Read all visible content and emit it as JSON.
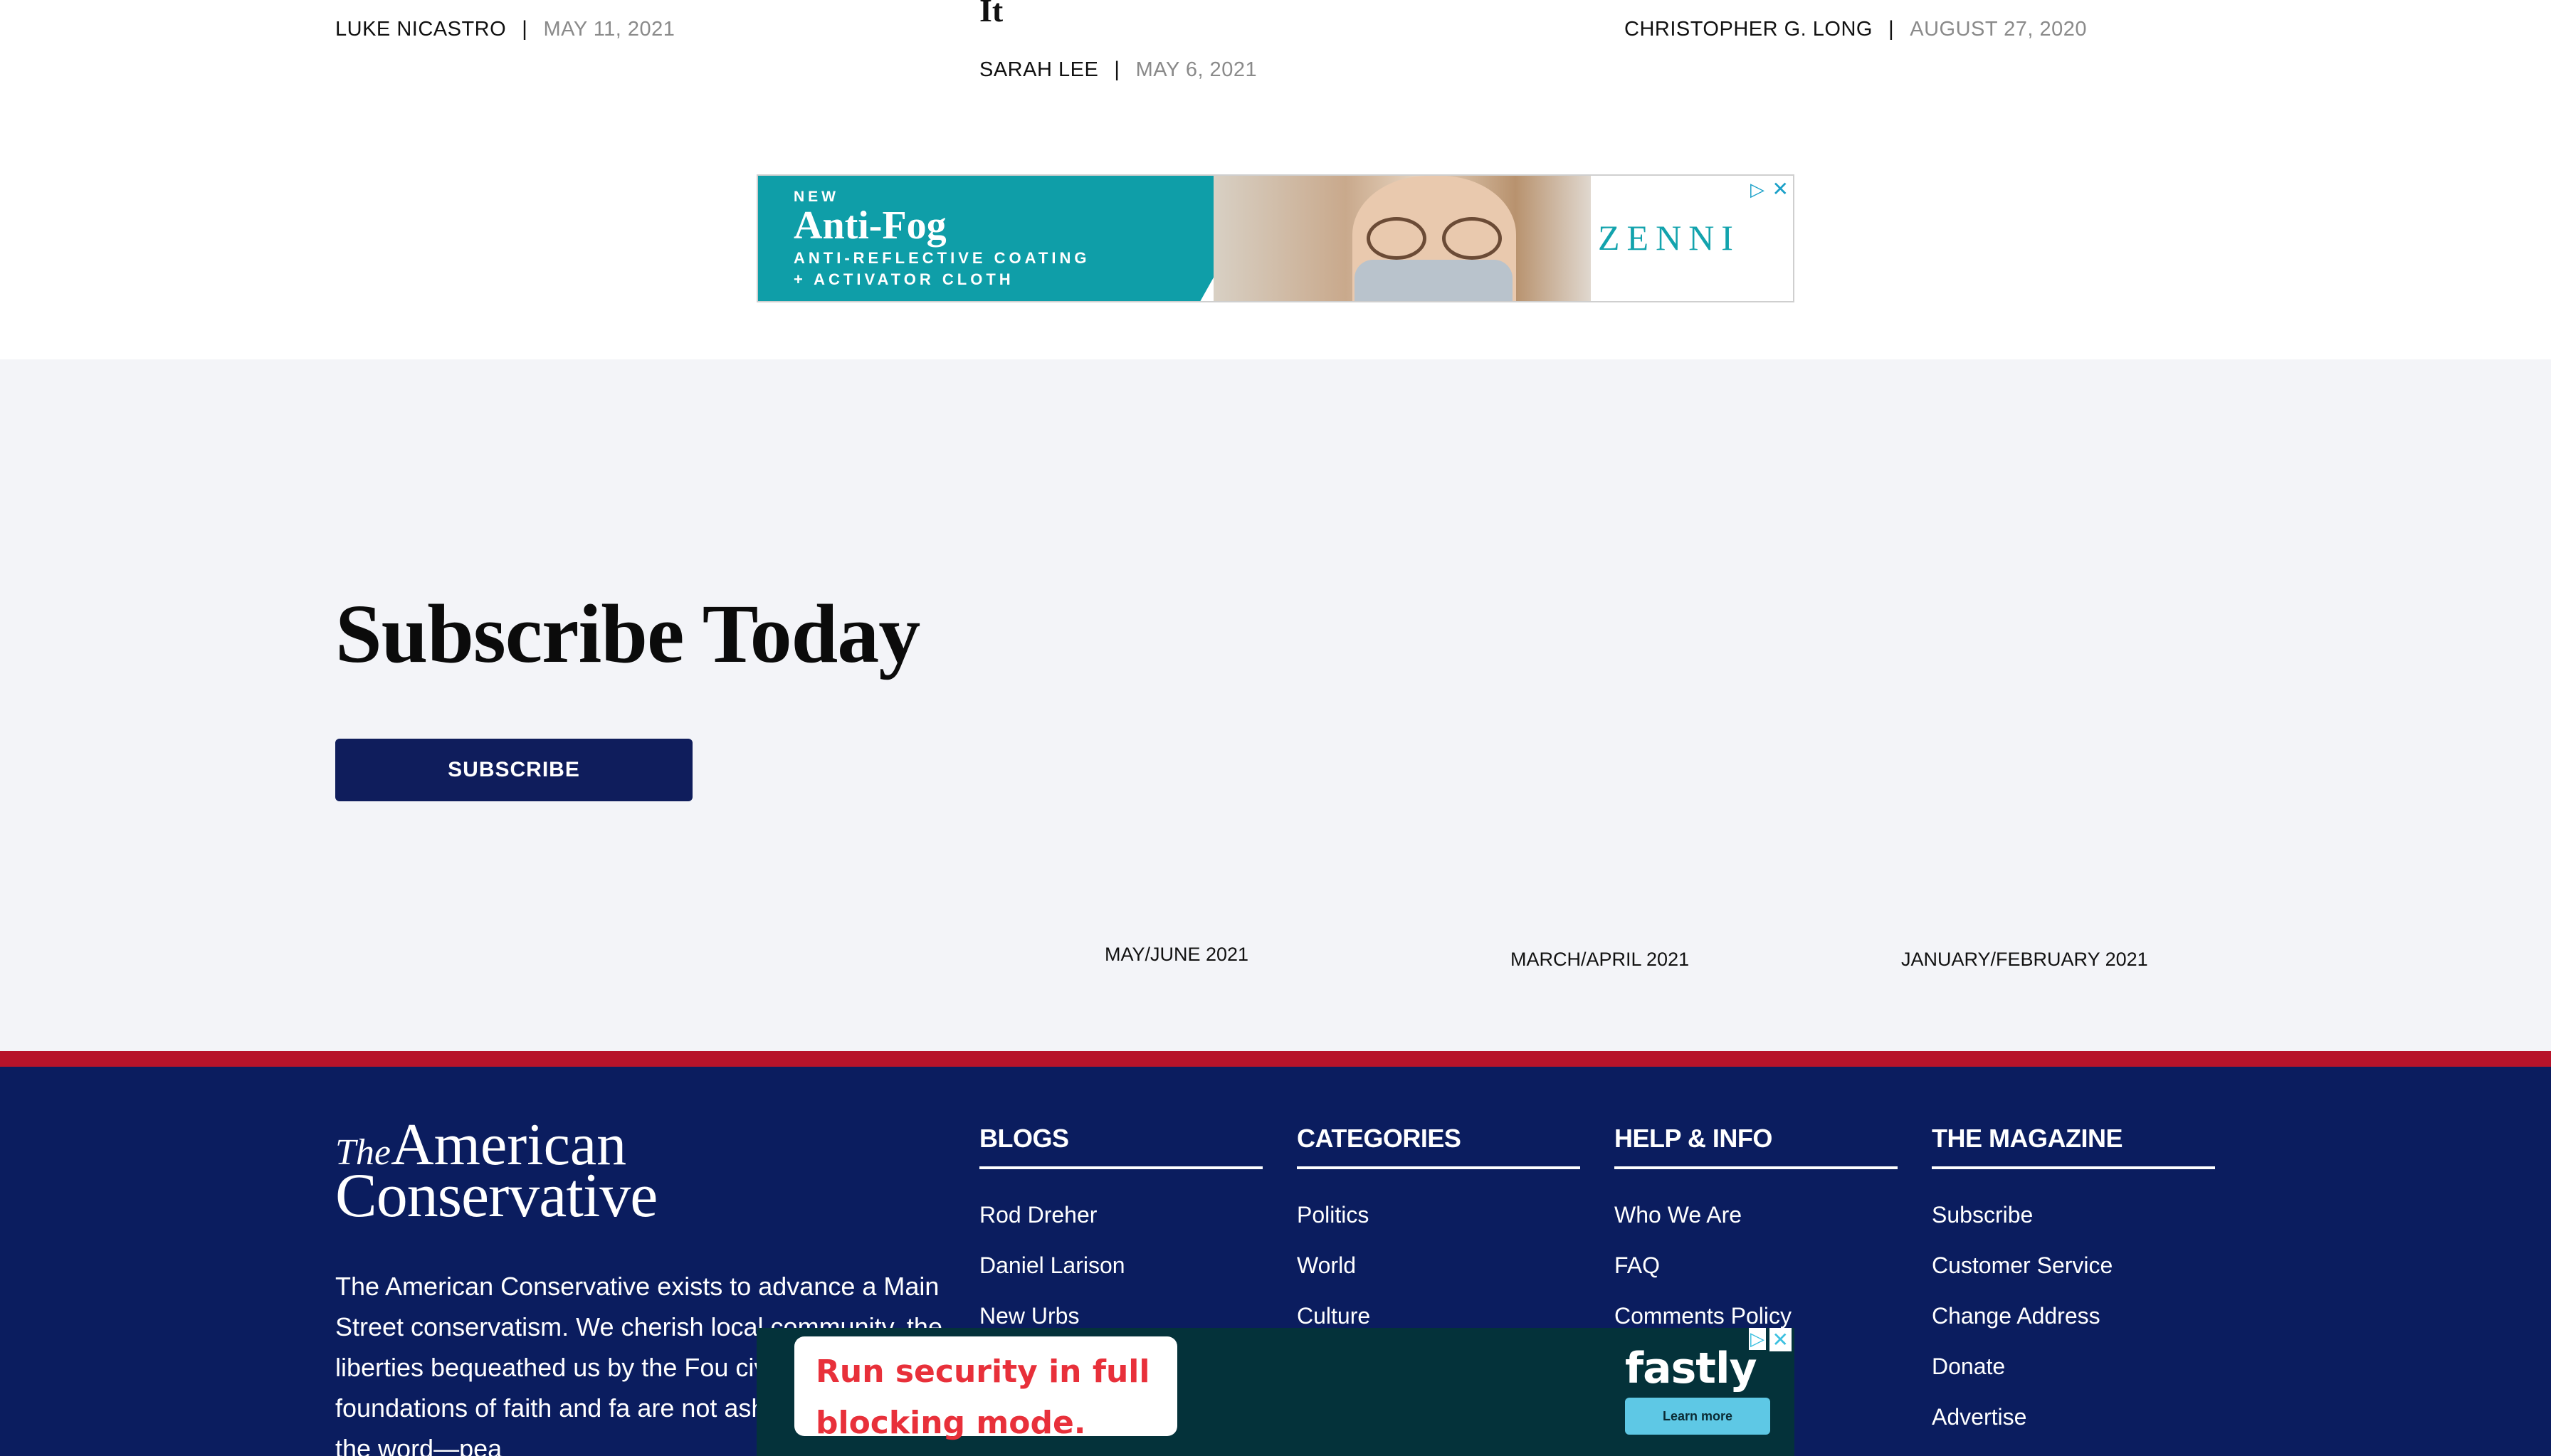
{
  "articles": [
    {
      "author": "LUKE NICASTRO",
      "date": "MAY 11, 2021"
    },
    {
      "headline_tail": "It",
      "author": "SARAH LEE",
      "date": "MAY 6, 2021"
    },
    {
      "author": "CHRISTOPHER G. LONG",
      "date": "AUGUST 27, 2020"
    }
  ],
  "byline_separator": "|",
  "ad_zenni": {
    "new": "NEW",
    "title": "Anti-Fog",
    "line1": "ANTI-REFLECTIVE COATING",
    "line2": "+ ACTIVATOR CLOTH",
    "brand": "ZENNI",
    "adchoices_icon": "adchoices-icon",
    "close_icon": "close-icon"
  },
  "subscribe": {
    "title": "Subscribe Today",
    "button_label": "SUBSCRIBE",
    "issues": [
      "MAY/JUNE 2021",
      "MARCH/APRIL 2021",
      "JANUARY/FEBRUARY 2021"
    ]
  },
  "footer": {
    "logo": {
      "the": "The",
      "american": "American",
      "conservative": "Conservative"
    },
    "mission": "The American Conservative exists to advance a Main Street conservatism. We cherish local community, the liberties bequeathed us by the Fou civilizational foundations of faith and fa are not ashamed to use the word—pea",
    "columns": [
      {
        "title": "BLOGS",
        "items": [
          "Rod Dreher",
          "Daniel Larison",
          "New Urbs"
        ]
      },
      {
        "title": "CATEGORIES",
        "items": [
          "Politics",
          "World",
          "Culture"
        ]
      },
      {
        "title": "HELP & INFO",
        "items": [
          "Who We Are",
          "FAQ",
          "Comments Policy"
        ]
      },
      {
        "title": "THE MAGAZINE",
        "items": [
          "Subscribe",
          "Customer Service",
          "Change Address",
          "Donate",
          "Advertise"
        ]
      }
    ],
    "colors": {
      "background": "#0b1d5f",
      "stripe": "#b7132a"
    }
  },
  "ad_fastly": {
    "line1": "Run security in full",
    "line2": "blocking mode.",
    "brand": "fastly",
    "cta": "Learn more"
  }
}
